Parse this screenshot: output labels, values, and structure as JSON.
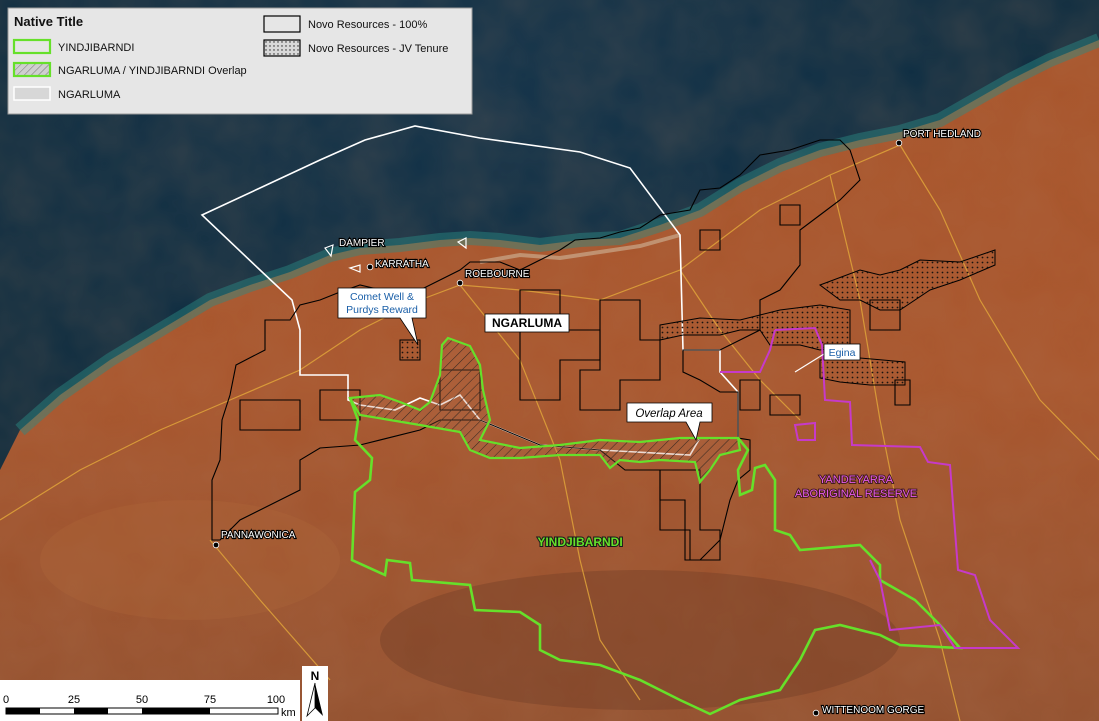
{
  "legend": {
    "title": "Native Title",
    "items": [
      {
        "label": "YINDJIBARNDI",
        "kind": "green-outline"
      },
      {
        "label": "NGARLUMA / YINDJIBARNDI Overlap",
        "kind": "green-hatch"
      },
      {
        "label": "NGARLUMA",
        "kind": "white-fill"
      },
      {
        "label": "Novo Resources - 100%",
        "kind": "black-outline"
      },
      {
        "label": "Novo Resources - JV Tenure",
        "kind": "black-dots"
      }
    ]
  },
  "places": {
    "port_hedland": "PORT HEDLAND",
    "dampier": "DAMPIER",
    "karratha": "KARRATHA",
    "roebourne": "ROEBOURNE",
    "pannawonica": "PANNAWONICA",
    "wittenoom": "WITTENOOM GORGE"
  },
  "regions": {
    "ngarluma": "NGARLUMA",
    "yindjibarndi": "YINDJIBARNDI",
    "yandeyarra_line1": "YANDEYARRA",
    "yandeyarra_line2": "ABORIGINAL RESERVE"
  },
  "callouts": {
    "comet_line1": "Comet Well &",
    "comet_line2": "Purdys Reward",
    "egina": "Egina",
    "overlap": "Overlap Area"
  },
  "scalebar": {
    "ticks": [
      "0",
      "25",
      "50",
      "75",
      "100"
    ],
    "unit": "km"
  },
  "north": "N",
  "colors": {
    "yindjibarndi": "#66e02a",
    "ngarluma": "#ffffff",
    "novo": "#000000",
    "yandeyarra": "#c63ac9",
    "callout": "#1a5fa8"
  }
}
